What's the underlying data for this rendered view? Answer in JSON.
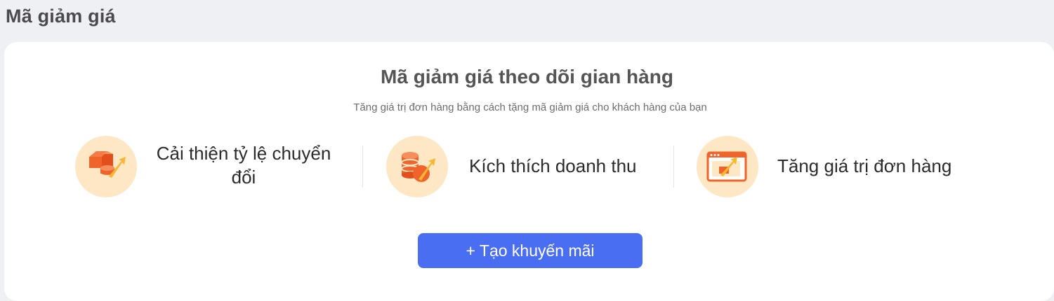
{
  "page": {
    "title": "Mã giảm giá"
  },
  "card": {
    "title": "Mã giảm giá theo dõi gian hàng",
    "subtitle": "Tăng giá trị đơn hàng bằng cách tặng mã giảm giá cho khách hàng của bạn",
    "features": [
      {
        "icon": "conversion-boxes-icon",
        "label": "Cải thiện tỷ lệ chuyển đổi"
      },
      {
        "icon": "revenue-coins-icon",
        "label": "Kích thích doanh thu"
      },
      {
        "icon": "order-value-window-icon",
        "label": "Tăng giá trị đơn hàng"
      }
    ],
    "create_button": {
      "plus": "+",
      "label": "Tạo khuyến mãi"
    }
  },
  "colors": {
    "page_bg": "#eff0f4",
    "card_bg": "#ffffff",
    "icon_circle": "#fde7c4",
    "icon_orange": "#f0632a",
    "icon_yellow": "#f7b731",
    "button_bg": "#4a6ef2"
  }
}
